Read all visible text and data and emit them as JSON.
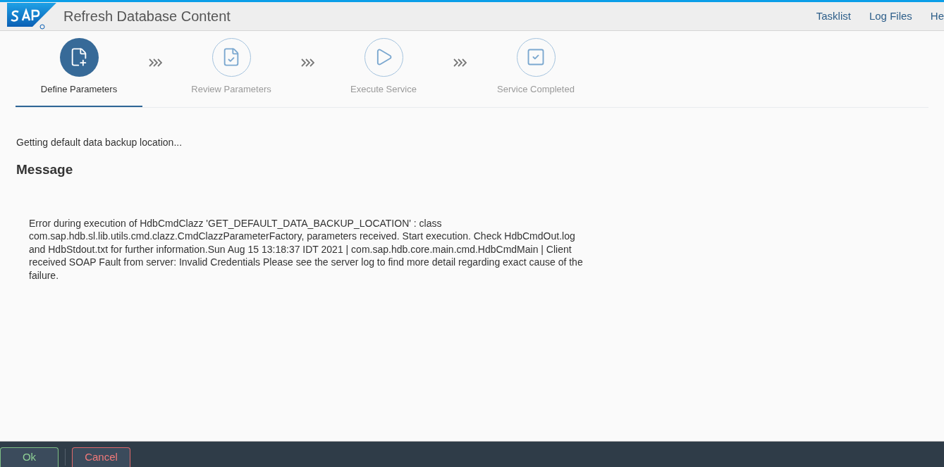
{
  "header": {
    "title": "Refresh Database Content",
    "links": [
      "Tasklist",
      "Log Files",
      "He"
    ]
  },
  "steps": [
    {
      "label": "Define Parameters",
      "selected": true,
      "kind": "define"
    },
    {
      "label": "Review Parameters",
      "selected": false,
      "kind": "review"
    },
    {
      "label": "Execute Service",
      "selected": false,
      "kind": "execute"
    },
    {
      "label": "Service Completed",
      "selected": false,
      "kind": "completed"
    }
  ],
  "status_text": "Getting default data backup location...",
  "message": {
    "heading": "Message",
    "text": "Error during execution of HdbCmdClazz 'GET_DEFAULT_DATA_BACKUP_LOCATION' : class com.sap.hdb.sl.lib.utils.cmd.clazz.CmdClazzParameterFactory, parameters received. Start execution. Check HdbCmdOut.log and HdbStdout.txt for further information.Sun Aug 15 13:18:37 IDT 2021 | com.sap.hdb.core.main.cmd.HdbCmdMain | Client received SOAP Fault from server: Invalid Credentials Please see the server log to find more detail regarding exact cause of the failure."
  },
  "footer_buttons": [
    {
      "label": "Ok",
      "kind": "accept"
    },
    {
      "label": "Cancel",
      "kind": "reject"
    }
  ]
}
